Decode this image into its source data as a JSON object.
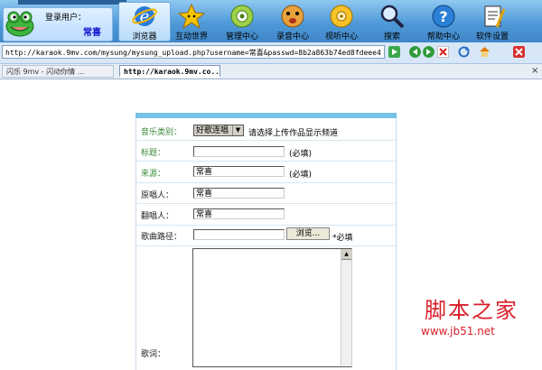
{
  "user": {
    "label": "登录用户：",
    "name": "常喜"
  },
  "toolbar": [
    {
      "id": "browser",
      "label": "浏览器",
      "icon": "ie-icon",
      "active": true
    },
    {
      "id": "interact",
      "label": "互动世界",
      "icon": "star-icon"
    },
    {
      "id": "manage",
      "label": "管理中心",
      "icon": "gear-icon"
    },
    {
      "id": "record",
      "label": "录音中心",
      "icon": "cookie-face-icon"
    },
    {
      "id": "listen",
      "label": "视听中心",
      "icon": "disc-icon"
    },
    {
      "id": "search",
      "label": "搜索",
      "icon": "magnifier-icon"
    },
    {
      "id": "help",
      "label": "帮助中心",
      "icon": "help-icon"
    },
    {
      "id": "settings",
      "label": "软件设置",
      "icon": "settings-doc-icon"
    }
  ],
  "address": {
    "url": "http://karaok.9mv.com/mysung/mysung_upload.php?username=常喜&passwd=8b2a863b74ed8fdeee4"
  },
  "tabs": [
    {
      "label": "闪乐 9mv - 闪动你情 ..."
    },
    {
      "label": "http://karaok.9mv.co..."
    }
  ],
  "form": {
    "category": {
      "label": "音乐类别：",
      "selected": "好歌连唱",
      "hint": "请选择上传作品显示频道"
    },
    "title": {
      "label": "标题：",
      "value": "",
      "note": "(必填)"
    },
    "source": {
      "label": "来源：",
      "value": "常喜",
      "note": "(必填)"
    },
    "original_singer": {
      "label": "原唱人：",
      "value": "常喜"
    },
    "cover_singer": {
      "label": "翻唱人：",
      "value": "常喜"
    },
    "song_path": {
      "label": "歌曲路径：",
      "value": "",
      "browse": "浏览...",
      "note": "*必填"
    },
    "lyrics": {
      "label": "歌词："
    }
  },
  "watermark": {
    "line1": "脚本之家",
    "line2": "www.jb51.net"
  }
}
